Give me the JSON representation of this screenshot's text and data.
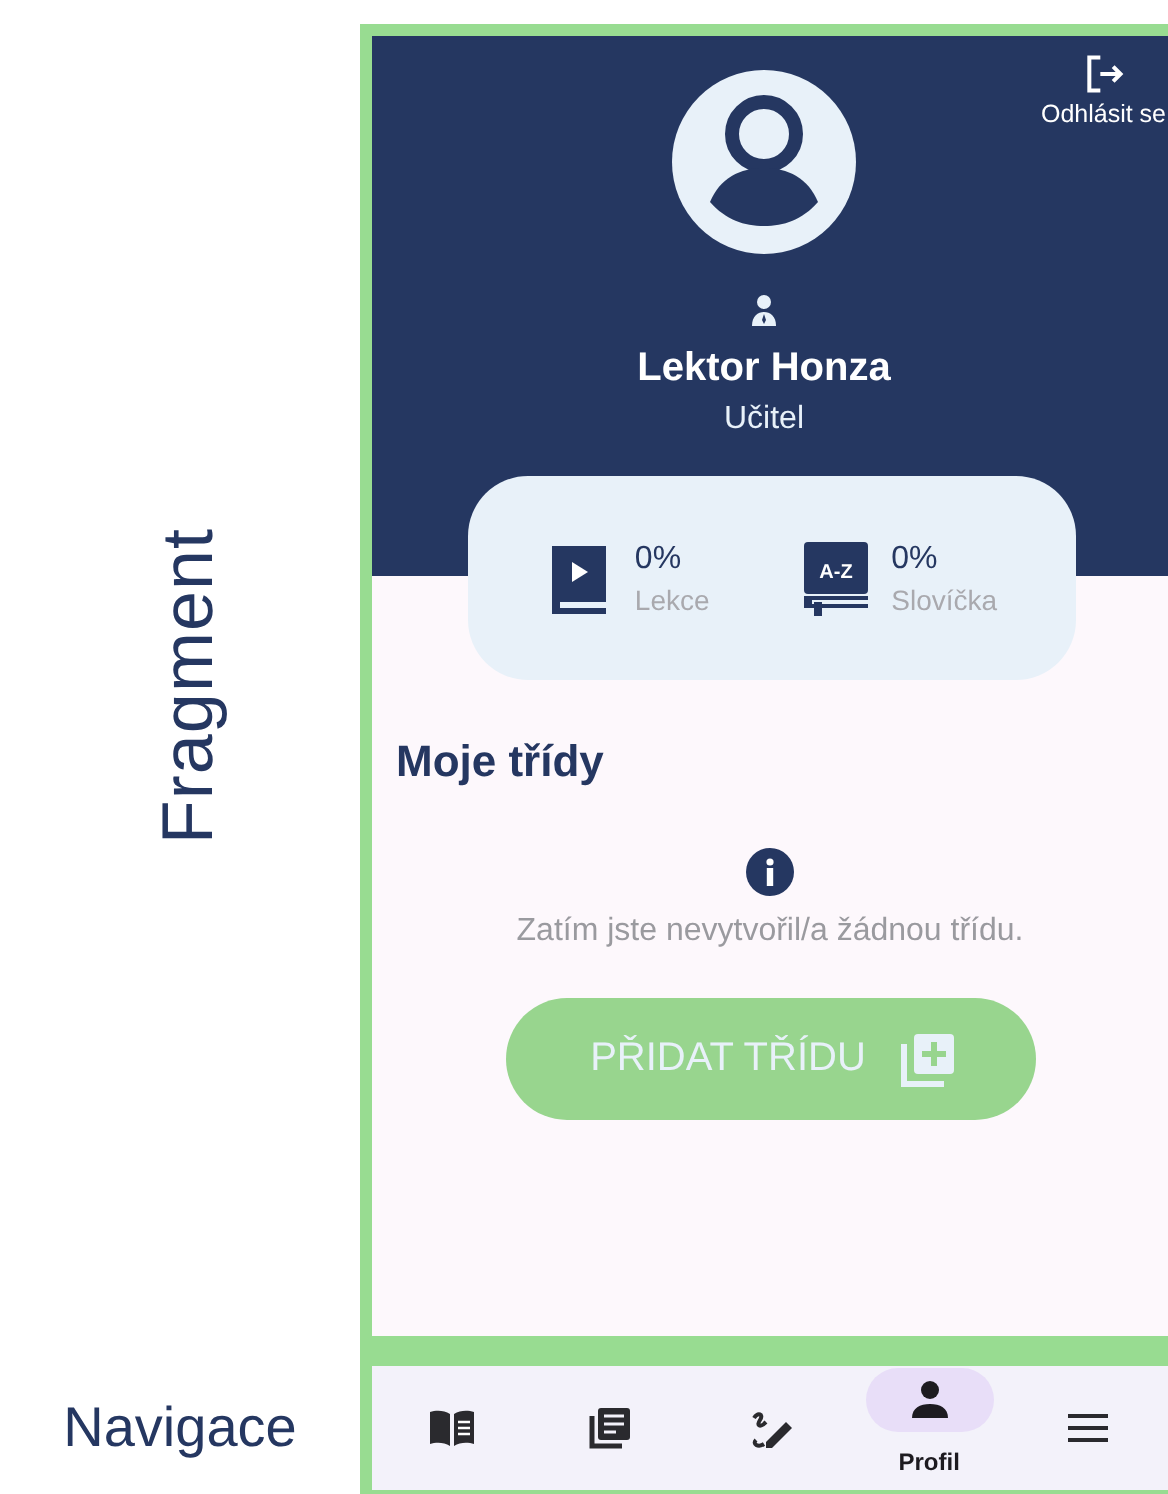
{
  "annotations": {
    "fragment_label": "Fragment",
    "navigation_label": "Navigace"
  },
  "header": {
    "logout_label": "Odhlásit se",
    "name": "Lektor Honza",
    "role": "Učitel"
  },
  "stats": [
    {
      "value": "0%",
      "label": "Lekce"
    },
    {
      "value": "0%",
      "label": "Slovíčka",
      "icon_text": "A-Z"
    }
  ],
  "classes": {
    "title": "Moje třídy",
    "empty_message": "Zatím jste nevytvořil/a žádnou třídu.",
    "add_button": "PŘIDAT TŘÍDU"
  },
  "navigation": [
    {
      "selected": false
    },
    {
      "selected": false
    },
    {
      "selected": false
    },
    {
      "label": "Profil",
      "selected": true
    },
    {
      "selected": false
    }
  ]
}
